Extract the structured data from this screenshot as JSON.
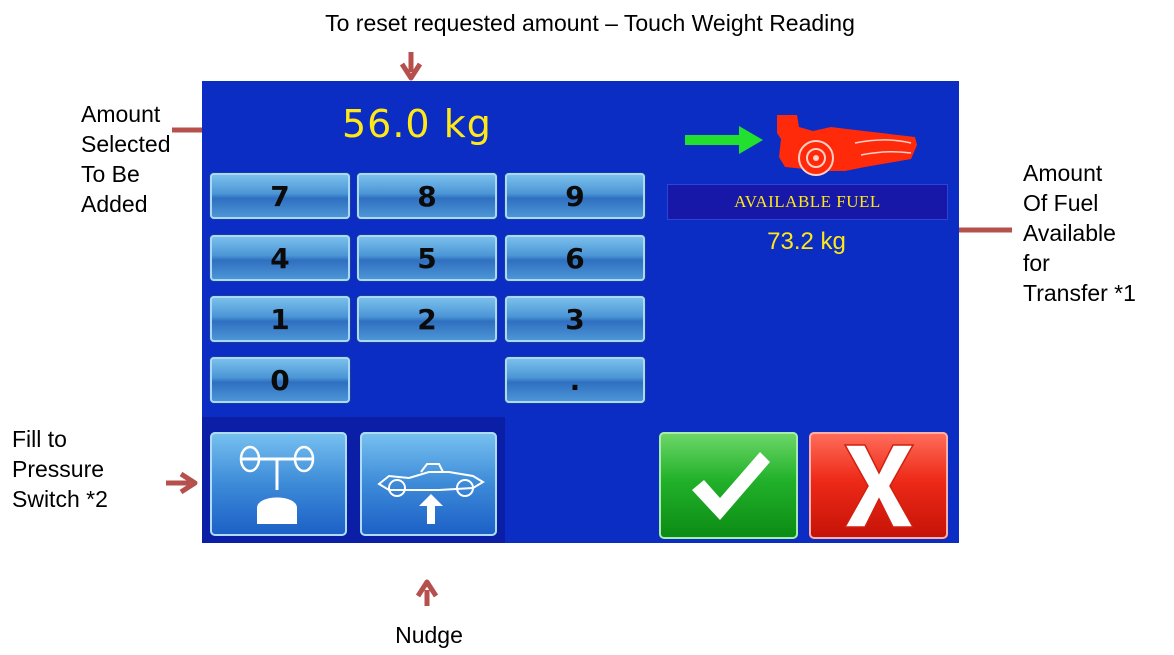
{
  "annotations": {
    "top": "To reset requested amount – Touch Weight Reading",
    "amount_selected": [
      "Amount",
      "Selected",
      "To Be",
      "Added"
    ],
    "available": [
      "Amount",
      "Of Fuel",
      "Available",
      "for",
      "Transfer *1"
    ],
    "fill_to_pressure": [
      "Fill to",
      "Pressure",
      "Switch *2"
    ],
    "nudge": "Nudge"
  },
  "screen": {
    "amount_selected": "56.0 kg",
    "available_fuel_label": "AVAILABLE FUEL",
    "available_fuel_value": "73.2 kg",
    "keypad": [
      "7",
      "8",
      "9",
      "4",
      "5",
      "6",
      "1",
      "2",
      "3",
      "0",
      "."
    ],
    "buttons": {
      "fill_to_pressure_icon": "pressure-switch-icon",
      "nudge_icon": "race-car-nudge-icon",
      "confirm_icon": "checkmark-icon",
      "cancel_icon": "x-icon"
    }
  },
  "colors": {
    "screen_bg": "#0b2dc4",
    "readout": "#ffe818",
    "arrow": "#b5504d",
    "car": "#ff2a0a",
    "direction_arrow": "#22e030"
  }
}
